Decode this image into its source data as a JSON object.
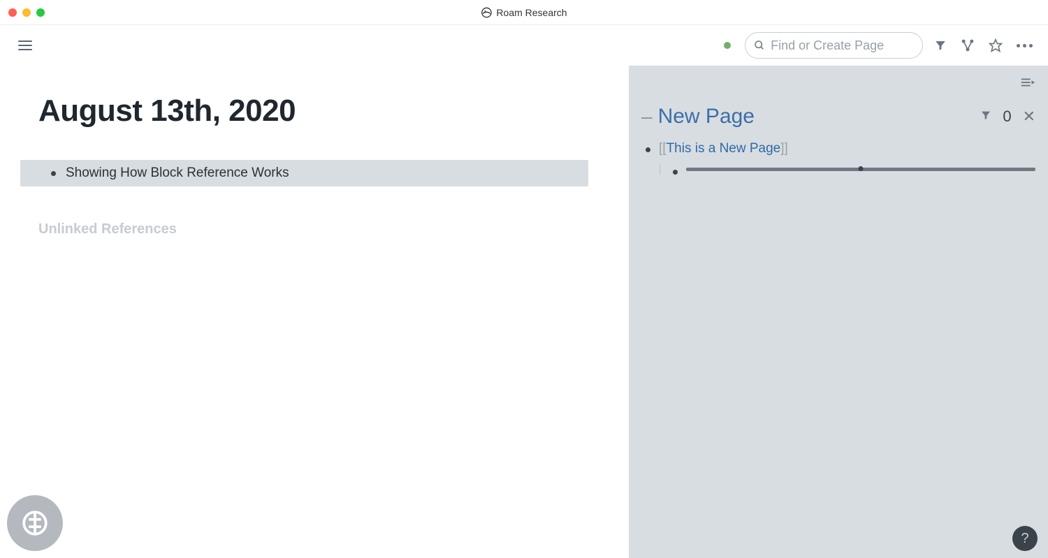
{
  "app": {
    "title": "Roam Research"
  },
  "toolbar": {
    "search_placeholder": "Find or Create Page"
  },
  "main": {
    "page_title": "August 13th, 2020",
    "block_text": "Showing How Block Reference Works",
    "unlinked_label": "Unlinked References"
  },
  "sidebar": {
    "title": "New Page",
    "filter_count": "0",
    "link_text": "This is a New Page",
    "bracket_open": "[[",
    "bracket_close": "]]"
  },
  "help": {
    "label": "?"
  }
}
